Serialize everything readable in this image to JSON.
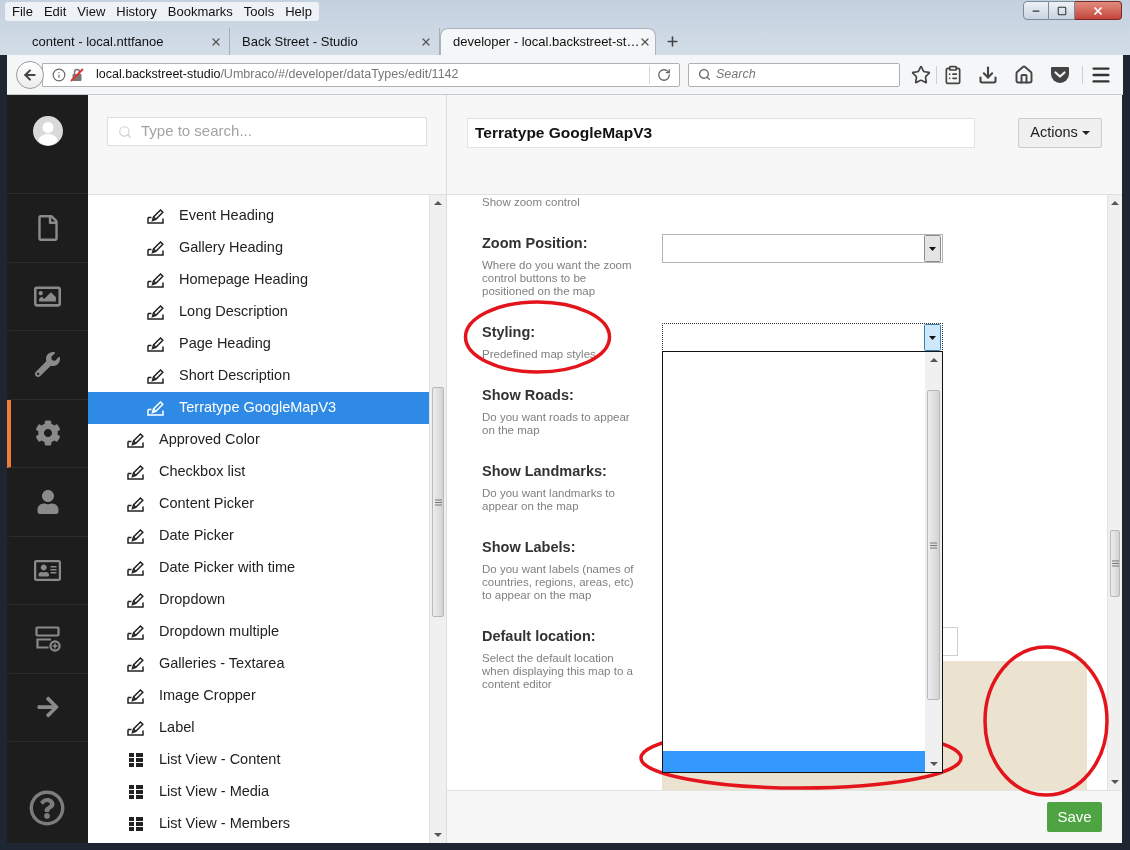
{
  "browser": {
    "menu": [
      "File",
      "Edit",
      "View",
      "History",
      "Bookmarks",
      "Tools",
      "Help"
    ],
    "tabs": [
      {
        "title": "content - local.nttfanoe",
        "selected": false
      },
      {
        "title": "Back Street - Studio",
        "selected": false
      },
      {
        "title": "developer - local.backstreet-st…",
        "selected": true
      }
    ],
    "address": {
      "host": "local.backstreet-studio",
      "path": "/Umbraco/#/developer/dataTypes/edit/1142"
    },
    "search": {
      "placeholder": "Search"
    }
  },
  "sections": [
    {
      "kind": "document",
      "selected": false
    },
    {
      "kind": "image",
      "selected": false
    },
    {
      "kind": "wrench",
      "selected": false
    },
    {
      "kind": "gear",
      "selected": true
    },
    {
      "kind": "user",
      "selected": false
    },
    {
      "kind": "card",
      "selected": false
    },
    {
      "kind": "layout",
      "selected": false
    },
    {
      "kind": "arrow",
      "selected": false
    }
  ],
  "tree": {
    "search": {
      "placeholder": "Type to search..."
    },
    "items": [
      {
        "children": [
          {
            "label": "Event Heading",
            "kind": "editor",
            "selected": false
          },
          {
            "label": "Gallery Heading",
            "kind": "editor",
            "selected": false
          },
          {
            "label": "Homepage Heading",
            "kind": "editor",
            "selected": false
          },
          {
            "label": "Long Description",
            "kind": "editor",
            "selected": false
          },
          {
            "label": "Page Heading",
            "kind": "editor",
            "selected": false
          },
          {
            "label": "Short Description",
            "kind": "editor",
            "selected": false
          },
          {
            "label": "Terratype GoogleMapV3",
            "kind": "editor",
            "selected": true
          }
        ]
      },
      {
        "label": "Approved Color",
        "kind": "editor",
        "selected": false
      },
      {
        "label": "Checkbox list",
        "kind": "editor",
        "selected": false
      },
      {
        "label": "Content Picker",
        "kind": "editor",
        "selected": false
      },
      {
        "label": "Date Picker",
        "kind": "editor",
        "selected": false
      },
      {
        "label": "Date Picker with time",
        "kind": "editor",
        "selected": false
      },
      {
        "label": "Dropdown",
        "kind": "editor",
        "selected": false
      },
      {
        "label": "Dropdown multiple",
        "kind": "editor",
        "selected": false
      },
      {
        "label": "Galleries - Textarea",
        "kind": "editor",
        "selected": false
      },
      {
        "label": "Image Cropper",
        "kind": "editor",
        "selected": false
      },
      {
        "label": "Label",
        "kind": "editor",
        "selected": false
      },
      {
        "label": "List View - Content",
        "kind": "list",
        "selected": false
      },
      {
        "label": "List View - Media",
        "kind": "list",
        "selected": false
      },
      {
        "label": "List View - Members",
        "kind": "list",
        "selected": false
      }
    ]
  },
  "editor": {
    "name": "Terratype GoogleMapV3",
    "actions": "Actions",
    "fields": [
      {
        "description": "Show zoom control"
      },
      {
        "label": "Zoom Position:",
        "description": "Where do you want the zoom control buttons to be positioned on the map",
        "kind": "select",
        "expanded": false
      },
      {
        "label": "Styling:",
        "description": "Predefined map styles",
        "kind": "select",
        "expanded": true
      },
      {
        "label": "Show Roads:",
        "description": "Do you want roads to appear on the map"
      },
      {
        "label": "Show Landmarks:",
        "description": "Do you want landmarks to appear on the map"
      },
      {
        "label": "Show Labels:",
        "description": "Do you want labels (names of countries, regions, areas, etc) to appear on the map"
      },
      {
        "label": "Default location:",
        "description": "Select the default location when displaying this map to a content editor",
        "kind": "location"
      }
    ],
    "save": "Save"
  }
}
